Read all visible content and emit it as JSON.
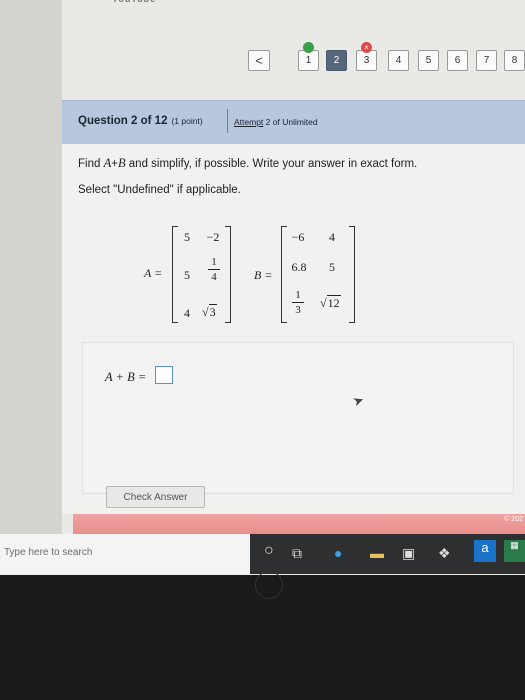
{
  "browser": {
    "tab_fragment": "YouTube"
  },
  "nav": {
    "back_symbol": "<",
    "questions": [
      {
        "label": "1",
        "status": "correct"
      },
      {
        "label": "2",
        "status": "current"
      },
      {
        "label": "3",
        "status": "incorrect"
      },
      {
        "label": "4",
        "status": "none"
      },
      {
        "label": "5",
        "status": "none"
      },
      {
        "label": "6",
        "status": "none"
      },
      {
        "label": "7",
        "status": "none"
      },
      {
        "label": "8",
        "status": "none"
      }
    ],
    "incorrect_mark": "×"
  },
  "question": {
    "title": "Question 2 of 12",
    "points": "(1 point)",
    "attempt_prefix": "Attempt",
    "attempt_suffix": " 2 of Unlimited",
    "instruction_a": "Find ",
    "instruction_sum": "A",
    "instruction_plus": "+",
    "instruction_sum2": "B",
    "instruction_b": " and simplify, if possible. Write your answer in exact form.",
    "instruction_2": "Select \"Undefined\" if applicable."
  },
  "matrix_a": {
    "label": "A =",
    "rows": [
      [
        "5",
        "−2"
      ],
      [
        "5",
        "1/4"
      ],
      [
        "4",
        "√3"
      ]
    ],
    "frac_num": "1",
    "frac_den": "4",
    "sqrt_val": "3"
  },
  "matrix_b": {
    "label": "B =",
    "rows": [
      [
        "−6",
        "4"
      ],
      [
        "6.8",
        "5"
      ],
      [
        "1/3",
        "√12"
      ]
    ],
    "frac_num": "1",
    "frac_den": "3",
    "sqrt_val": "12"
  },
  "answer": {
    "label": "A + B  =",
    "value": ""
  },
  "check_button": "Check Answer",
  "copyright": "© 202",
  "taskbar": {
    "search_placeholder": "Type here to search"
  },
  "colors": {
    "header_bg": "#b7c7dd",
    "current_q": "#55657a",
    "correct": "#3c9d4a",
    "incorrect": "#d94c4c",
    "answer_border": "#5a8fd0"
  }
}
